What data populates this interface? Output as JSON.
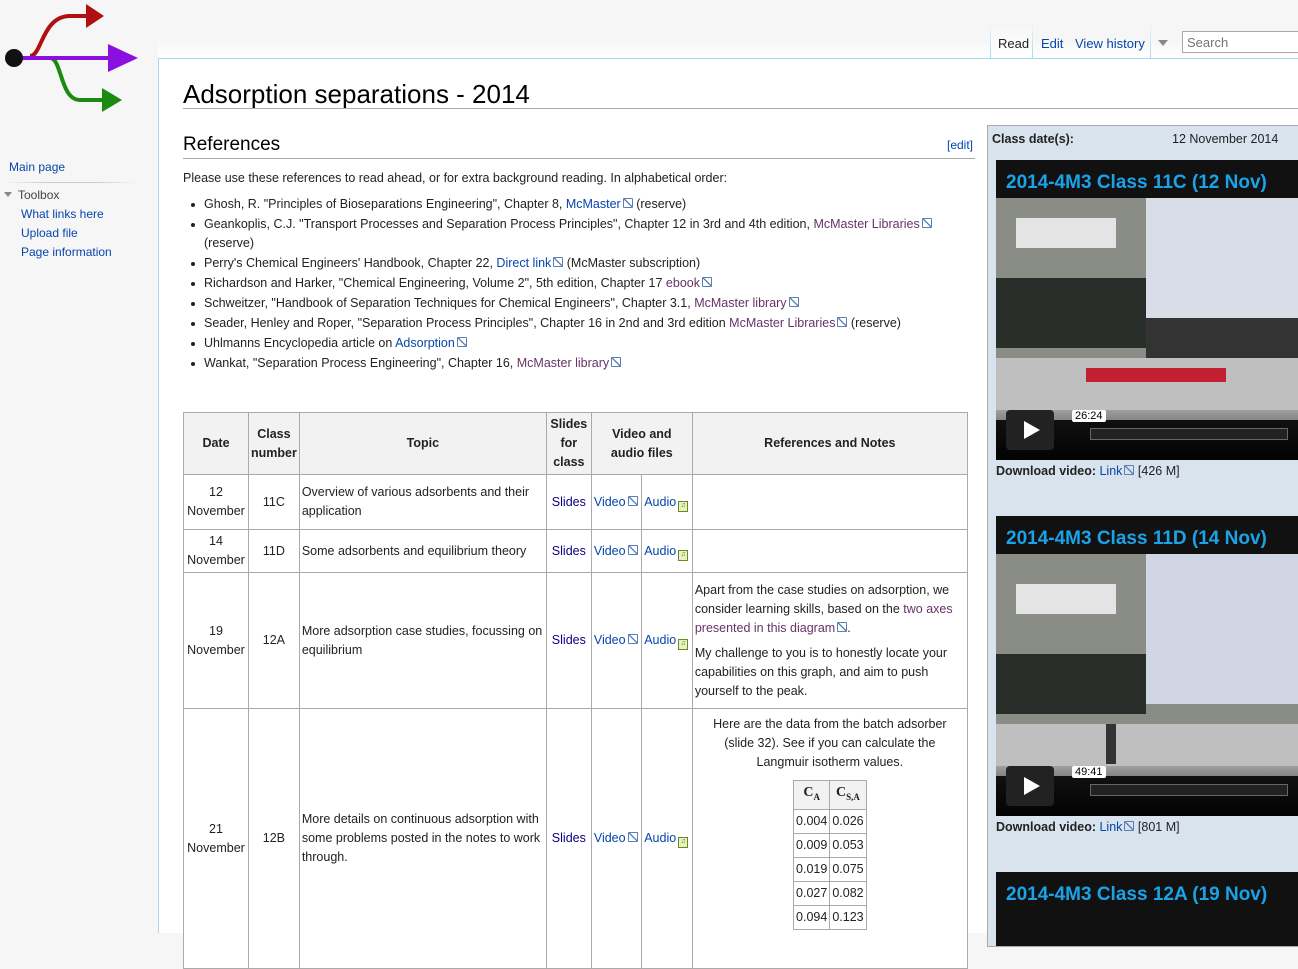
{
  "sidebar": {
    "main_page": "Main page",
    "toolbox_label": "Toolbox",
    "toolbox_items": [
      "What links here",
      "Upload file",
      "Page information"
    ]
  },
  "tabs": {
    "read": "Read",
    "edit": "Edit",
    "view_history": "View history",
    "search_placeholder": "Search"
  },
  "page": {
    "title": "Adsorption separations - 2014",
    "section_heading": "References",
    "edit_link": "[edit]",
    "intro": "Please use these references to read ahead, or for extra background reading. In alphabetical order:"
  },
  "references": [
    {
      "pre": "Ghosh, R. \"Principles of Bioseparations Engineering\", Chapter 8, ",
      "link": "McMaster",
      "post": " (reserve)"
    },
    {
      "pre": "Geankoplis, C.J. \"Transport Processes and Separation Process Principles\", Chapter 12 in 3rd and 4th edition, ",
      "link": "McMaster Libraries",
      "post": " (reserve)"
    },
    {
      "pre": "Perry's Chemical Engineers' Handbook, Chapter 22, ",
      "link": "Direct link",
      "post": " (McMaster subscription)"
    },
    {
      "pre": "Richardson and Harker, \"Chemical Engineering, Volume 2\", 5th edition, Chapter 17 ",
      "link": "ebook",
      "post": ""
    },
    {
      "pre": "Schweitzer, \"Handbook of Separation Techniques for Chemical Engineers\", Chapter 3.1, ",
      "link": "McMaster library",
      "post": ""
    },
    {
      "pre": "Seader, Henley and Roper, \"Separation Process Principles\", Chapter 16 in 2nd and 3rd edition ",
      "link": "McMaster Libraries",
      "post": " (reserve)"
    },
    {
      "pre": "Uhlmanns Encyclopedia article on ",
      "link": "Adsorption",
      "post": ""
    },
    {
      "pre": "Wankat, \"Separation Process Engineering\", Chapter 16, ",
      "link": "McMaster library",
      "post": ""
    }
  ],
  "schedule": {
    "headers": {
      "date": "Date",
      "class_number": "Class number",
      "topic": "Topic",
      "slides": "Slides for class",
      "video_audio": "Video and audio files",
      "notes": "References and Notes"
    },
    "rows": [
      {
        "date": "12 November",
        "class": "11C",
        "topic": "Overview of various adsorbents and their application",
        "slides": "Slides",
        "video": "Video",
        "audio": "Audio"
      },
      {
        "date": "14 November",
        "class": "11D",
        "topic": "Some adsorbents and equilibrium theory",
        "slides": "Slides",
        "video": "Video",
        "audio": "Audio"
      },
      {
        "date": "19 November",
        "class": "12A",
        "topic": "More adsorption case studies, focussing on equilibrium",
        "slides": "Slides",
        "video": "Video",
        "audio": "Audio",
        "notes_p1_pre": "Apart from the case studies on adsorption, we consider learning skills, based on the ",
        "notes_p1_link": "two axes presented in this diagram",
        "notes_p1_post": ".",
        "notes_p2": "My challenge to you is to honestly locate your capabilities on this graph, and aim to push yourself to the peak."
      },
      {
        "date": "21 November",
        "class": "12B",
        "topic": "More details on continuous adsorption with some problems posted in the notes to work through.",
        "slides": "Slides",
        "video": "Video",
        "audio": "Audio",
        "notes_intro": "Here are the data from the batch adsorber (slide 32). See if you can calculate the Langmuir isotherm values."
      }
    ],
    "langmuir": {
      "col1": "C",
      "col1_sub": "A",
      "col2": "C",
      "col2_sub": "S,A",
      "rows": [
        [
          "0.004",
          "0.026"
        ],
        [
          "0.009",
          "0.053"
        ],
        [
          "0.019",
          "0.075"
        ],
        [
          "0.027",
          "0.082"
        ],
        [
          "0.094",
          "0.123"
        ]
      ]
    }
  },
  "right_panel": {
    "class_dates_label": "Class date(s):",
    "class_dates_value": "12 November 2014",
    "videos": [
      {
        "title": "2014-4M3 Class 11C (12 Nov)",
        "time": "26:24",
        "download_label": "Download video:",
        "link": "Link",
        "size": "[426 M]"
      },
      {
        "title": "2014-4M3 Class 11D (14 Nov)",
        "time": "49:41",
        "download_label": "Download video:",
        "link": "Link",
        "size": "[801 M]"
      },
      {
        "title": "2014-4M3 Class 12A (19 Nov)"
      }
    ]
  },
  "colors": {
    "link": "#0645ad",
    "visited": "#663366",
    "logo_red": "#b01010",
    "logo_purple": "#8a10e0",
    "logo_green": "#1a8a10",
    "video_title": "#1aa3e8"
  }
}
